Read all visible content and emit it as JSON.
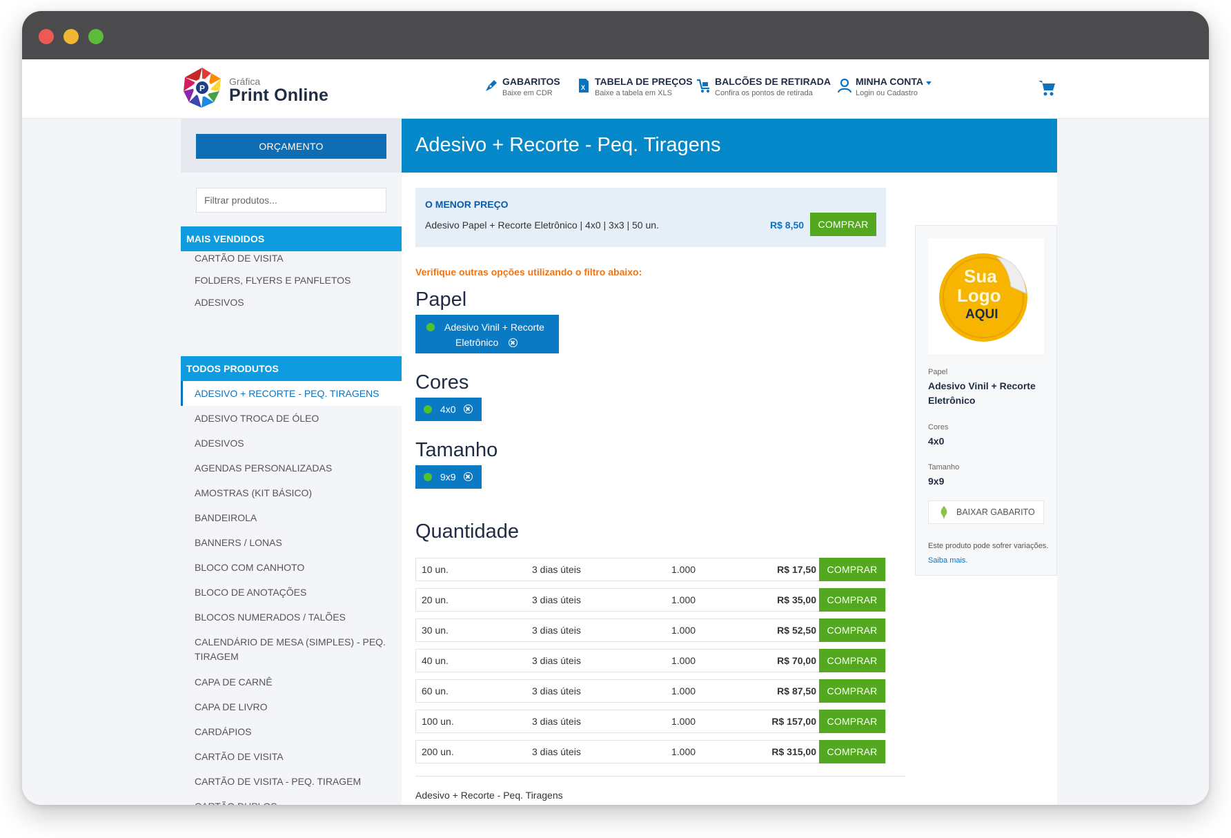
{
  "header": {
    "logo_small": "Gráfica",
    "logo_big": "Print Online",
    "nav": [
      {
        "title": "GABARITOS",
        "sub": "Baixe em CDR",
        "icon": "pen-icon"
      },
      {
        "title": "TABELA DE PREÇOS",
        "sub": "Baixe a tabela em XLS",
        "icon": "spreadsheet-icon"
      },
      {
        "title": "BALCÕES DE RETIRADA",
        "sub": "Confira os pontos de retirada",
        "icon": "delivery-cart-icon"
      },
      {
        "title": "MINHA CONTA",
        "sub": "Login ou Cadastro",
        "icon": "user-icon"
      }
    ]
  },
  "sidebar": {
    "quote_button": "ORÇAMENTO",
    "filter_placeholder": "Filtrar produtos...",
    "best_sellers_title": "MAIS VENDIDOS",
    "best_sellers": [
      "CARTÃO DE VISITA",
      "FOLDERS, FLYERS E PANFLETOS",
      "ADESIVOS"
    ],
    "all_products_title": "TODOS PRODUTOS",
    "products": [
      "ADESIVO + RECORTE - PEQ. TIRAGENS",
      "ADESIVO TROCA DE ÓLEO",
      "ADESIVOS",
      "AGENDAS PERSONALIZADAS",
      "AMOSTRAS (KIT BÁSICO)",
      "BANDEIROLA",
      "BANNERS / LONAS",
      "BLOCO COM CANHOTO",
      "BLOCO DE ANOTAÇÕES",
      "BLOCOS NUMERADOS / TALÕES",
      "CALENDÁRIO DE MESA (SIMPLES) - PEQ. TIRAGEM",
      "CAPA DE CARNÊ",
      "CAPA DE LIVRO",
      "CARDÁPIOS",
      "CARTÃO DE VISITA",
      "CARTÃO DE VISITA - PEQ. TIRAGEM",
      "CARTÃO DUPLOS"
    ]
  },
  "main": {
    "title": "Adesivo + Recorte - Peq. Tiragens",
    "best_price": {
      "title": "O MENOR PREÇO",
      "description": "Adesivo Papel + Recorte Eletrônico | 4x0 | 3x3 | 50 un.",
      "price": "R$ 8,50",
      "button": "COMPRAR"
    },
    "hint": "Verifique outras opções utilizando o filtro abaixo:",
    "filters": {
      "paper_title": "Papel",
      "paper_line1": "Adesivo Vinil + Recorte",
      "paper_line2": "Eletrônico",
      "colors_title": "Cores",
      "colors_value": "4x0",
      "size_title": "Tamanho",
      "size_value": "9x9"
    },
    "quantity_title": "Quantidade",
    "quantities": [
      {
        "qty": "10 un.",
        "days": "3 dias úteis",
        "volume": "1.000",
        "price": "R$ 17,50"
      },
      {
        "qty": "20 un.",
        "days": "3 dias úteis",
        "volume": "1.000",
        "price": "R$ 35,00"
      },
      {
        "qty": "30 un.",
        "days": "3 dias úteis",
        "volume": "1.000",
        "price": "R$ 52,50"
      },
      {
        "qty": "40 un.",
        "days": "3 dias úteis",
        "volume": "1.000",
        "price": "R$ 70,00"
      },
      {
        "qty": "60 un.",
        "days": "3 dias úteis",
        "volume": "1.000",
        "price": "R$ 87,50"
      },
      {
        "qty": "100 un.",
        "days": "3 dias úteis",
        "volume": "1.000",
        "price": "R$ 157,00"
      },
      {
        "qty": "200 un.",
        "days": "3 dias úteis",
        "volume": "1.000",
        "price": "R$ 315,00"
      }
    ],
    "buy_label": "COMPRAR",
    "footer_name": "Adesivo + Recorte - Peq. Tiragens"
  },
  "summary": {
    "thumb_text_1": "Sua",
    "thumb_text_2": "Logo",
    "thumb_text_3": "AQUI",
    "paper_label": "Papel",
    "paper_value": "Adesivo Vinil + Recorte Eletrônico",
    "colors_label": "Cores",
    "colors_value": "4x0",
    "size_label": "Tamanho",
    "size_value": "9x9",
    "download_button": "BAIXAR GABARITO",
    "note": "Este produto pode sofrer variações.",
    "note_link": "Saiba mais."
  },
  "colors": {
    "primary": "#0488c9",
    "sidebar_head": "#0e9be0",
    "buy_green": "#53a81f",
    "hint_orange": "#f07314"
  }
}
